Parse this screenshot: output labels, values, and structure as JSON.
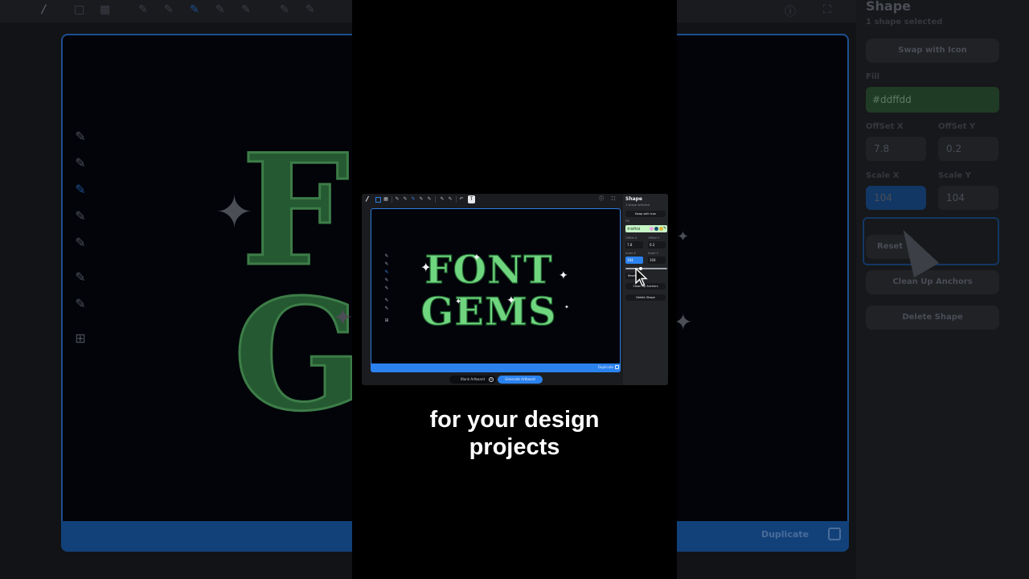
{
  "app": {
    "logo": "/",
    "panel_title": "Shape",
    "panel_subtitle": "1 shape selected",
    "swap_button": "Swap with Icon",
    "fill_label": "Fill",
    "fill_value": "#ddffdd",
    "offset_x_label": "OffSet X",
    "offset_y_label": "OffSet Y",
    "offset_x": "7.8",
    "offset_y": "0.2",
    "scale_x_label": "Scale X",
    "scale_y_label": "Scale Y",
    "scale_x": "104",
    "scale_y": "104",
    "reset_button": "Reset",
    "cleanup_button": "Clean Up Anchors",
    "delete_button": "Delete Shape",
    "duplicate_label": "Duplicate",
    "blank_artboard": "Blank Artboard",
    "generate_artboard": "Generate Artboard",
    "artwork_line1": "FONT",
    "artwork_line2": "GEMS",
    "fill_color": "#ddffdd",
    "accent_color": "#2b82ee"
  },
  "background_panel": {
    "title": "Shape",
    "subtitle": "1 shape selected",
    "swap_button": "Swap with Icon",
    "fill_label": "Fill",
    "fill_value": "#ddffdd",
    "offset_x_label": "OffSet X",
    "offset_y_label": "OffSet Y",
    "offset_x": "7.8",
    "offset_y": "0.2",
    "scale_x_label": "Scale X",
    "scale_y_label": "Scale Y",
    "scale_x": "104",
    "scale_y": "104",
    "reset_button": "Reset",
    "cleanup_button": "Clean Up Anchors",
    "delete_button": "Delete Shape",
    "duplicate_label": "Duplicate",
    "artwork_line1": "FO",
    "artwork_line2": "G"
  },
  "caption": {
    "line1": "for your design",
    "line2": "projects"
  }
}
